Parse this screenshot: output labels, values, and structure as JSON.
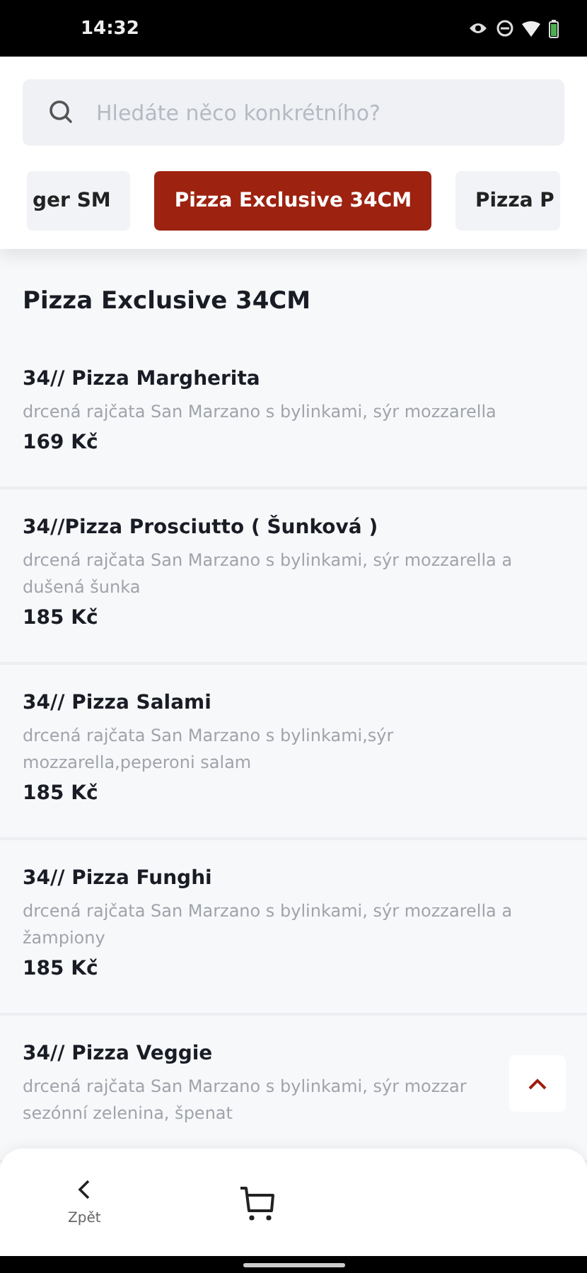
{
  "status_bar": {
    "time": "14:32"
  },
  "search": {
    "placeholder": "Hledáte něco konkrétního?"
  },
  "tabs": [
    {
      "label": "ger SM",
      "selected": false
    },
    {
      "label": "Pizza Exclusive 34CM",
      "selected": true
    },
    {
      "label": "Pizza P",
      "selected": false
    }
  ],
  "section_title": "Pizza Exclusive 34CM",
  "items": [
    {
      "name": "34// Pizza Margherita",
      "description": "drcená rajčata San Marzano s bylinkami, sýr mozzarella",
      "price": "169 Kč"
    },
    {
      "name": "34//Pizza Prosciutto ( Šunková )",
      "description": "drcená rajčata San Marzano s bylinkami, sýr mozzarella a dušená šunka",
      "price": "185 Kč"
    },
    {
      "name": "34// Pizza Salami",
      "description": "drcená rajčata San Marzano s bylinkami,sýr mozzarella,peperoni salam",
      "price": "185 Kč"
    },
    {
      "name": "34// Pizza Funghi",
      "description": "drcená rajčata San Marzano s bylinkami, sýr mozzarella a žampiony",
      "price": "185 Kč"
    },
    {
      "name": "34// Pizza Veggie",
      "description": "drcená rajčata San Marzano s bylinkami, sýr mozzar\nsezónní zelenina, špenat"
    }
  ],
  "bottom_nav": {
    "back_label": "Zpět"
  }
}
